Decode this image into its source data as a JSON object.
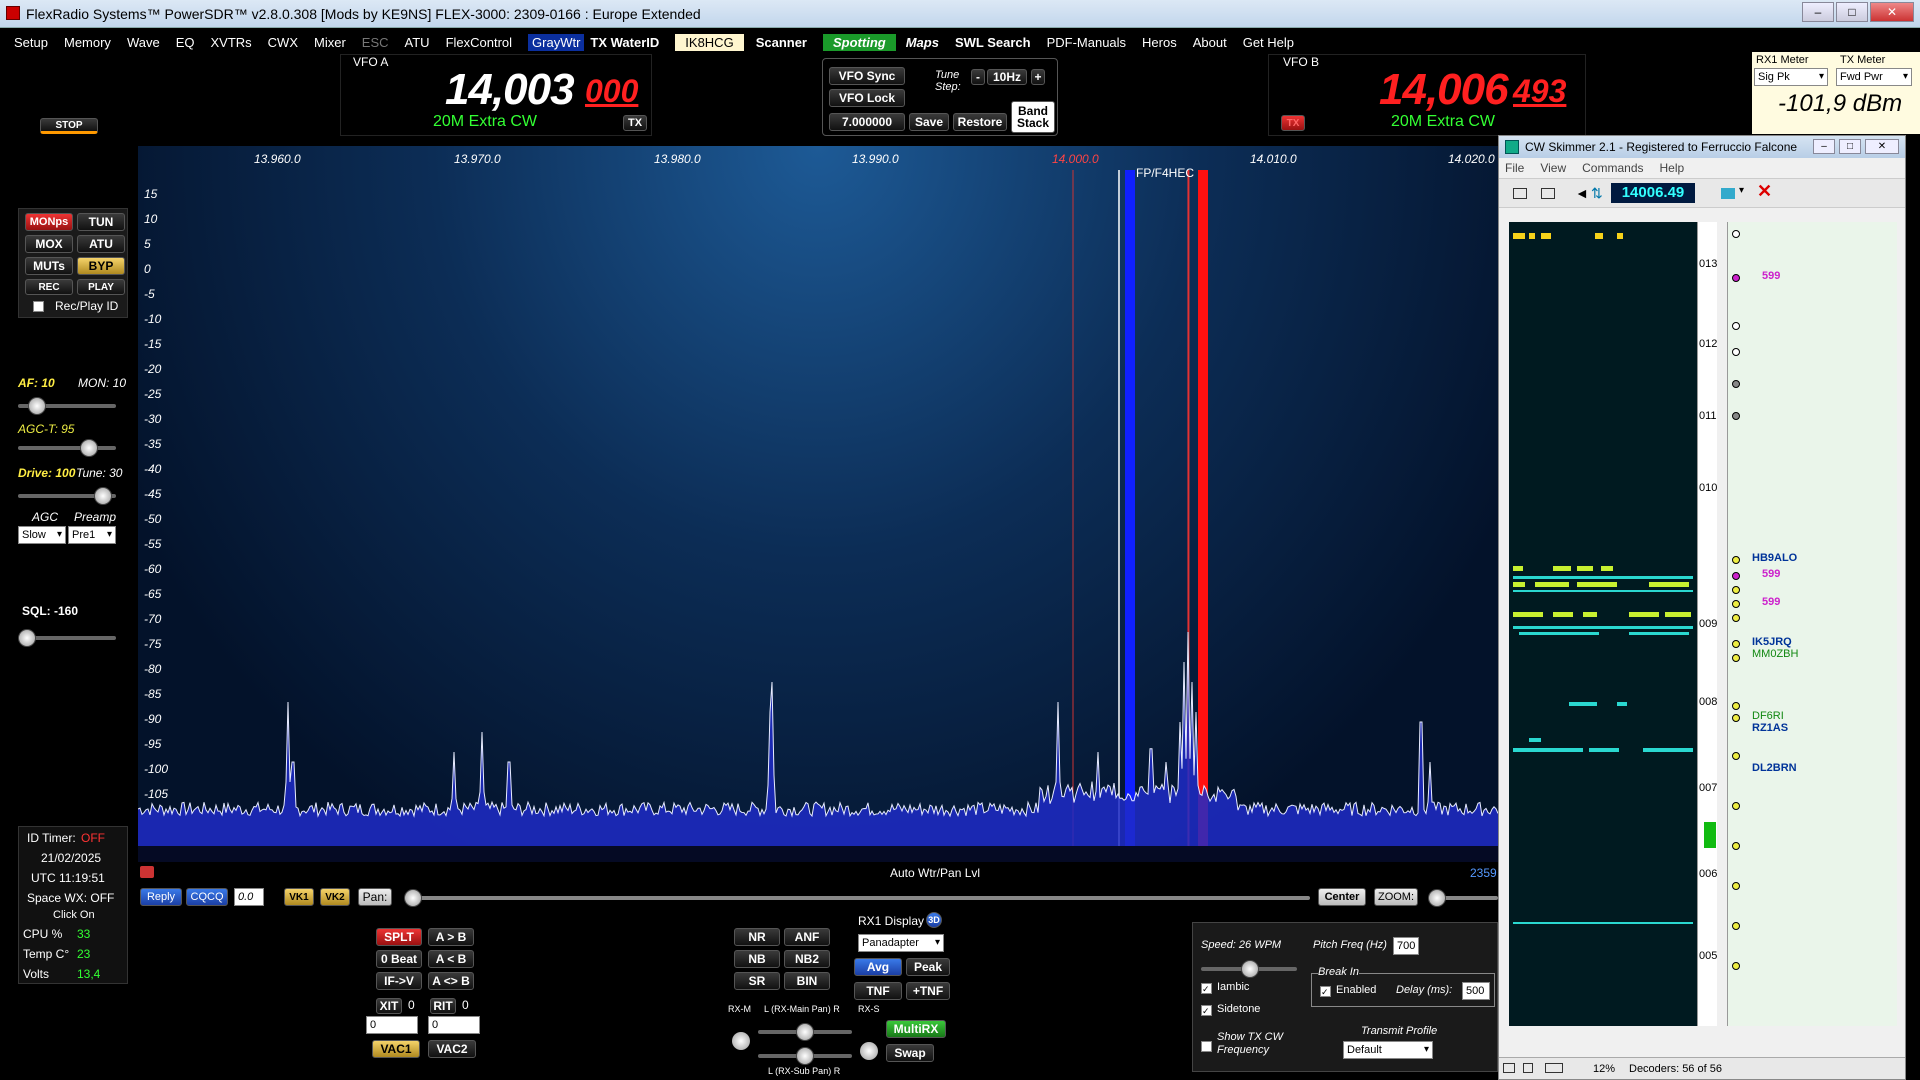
{
  "window": {
    "title": "FlexRadio Systems™  PowerSDR™  v2.8.0.308   [Mods by KE9NS]   FLEX-3000: 2309-0166 : Europe Extended"
  },
  "menu": [
    "Setup",
    "Memory",
    "Wave",
    "EQ",
    "XVTRs",
    "CWX",
    "Mixer",
    "ESC",
    "ATU",
    "FlexControl",
    "GrayWtr",
    "TX WaterID",
    "IK8HCG",
    "Scanner",
    "Spotting",
    "Maps",
    "SWL Search",
    "PDF-Manuals",
    "Heros",
    "About",
    "Get Help"
  ],
  "vfoA": {
    "label": "VFO A",
    "main": "14,003",
    "sub": "000",
    "band": "20M Extra CW",
    "tx": "TX"
  },
  "vfoB": {
    "label": "VFO B",
    "main": "14,006",
    "sub": "493",
    "band": "20M Extra CW",
    "tx": "TX"
  },
  "center": {
    "vfo_sync": "VFO Sync",
    "vfo_lock": "VFO Lock",
    "tune_label": "Tune Step:",
    "tune_step": "10Hz",
    "minus": "-",
    "plus": "+",
    "freq_box": "7.000000",
    "save": "Save",
    "restore": "Restore",
    "band_stack": "Band Stack"
  },
  "left": {
    "stop": "STOP",
    "buttons": [
      "MONps",
      "TUN",
      "MOX",
      "ATU",
      "MUTs",
      "BYP",
      "REC",
      "PLAY"
    ],
    "recplay": "Rec/Play ID",
    "af": "AF: 10",
    "mon": "MON: 10",
    "agct": "AGC-T: 95",
    "drive": "Drive: 100",
    "tune": "Tune: 30",
    "agc_label": "AGC",
    "preamp_label": "Preamp",
    "agc_value": "Slow",
    "preamp_value": "Pre1",
    "sql": "SQL: -160"
  },
  "status": {
    "id_timer_label": "ID Timer:",
    "id_timer_value": "OFF",
    "date": "21/02/2025",
    "utc": "UTC  11:19:51",
    "spacewx": "Space WX: OFF",
    "click_on": "Click On",
    "cpu_label": "CPU %",
    "cpu_value": "33",
    "temp_label": "Temp C°",
    "temp_value": "23",
    "volts_label": "Volts",
    "volts_value": "13,4"
  },
  "pan": {
    "y_labels": [
      "15",
      "10",
      "5",
      "0",
      "-5",
      "-10",
      "-15",
      "-20",
      "-25",
      "-30",
      "-35",
      "-40",
      "-45",
      "-50",
      "-55",
      "-60",
      "-65",
      "-70",
      "-75",
      "-80",
      "-85",
      "-90",
      "-95",
      "-100",
      "-105"
    ],
    "x_labels": [
      "13.960.0",
      "13.970.0",
      "13.980.0",
      "13.990.0",
      "14.000.0",
      "14.010.0",
      "14.020.0"
    ],
    "spot": "FP/F4HEC",
    "bottom_label": "Auto Wtr/Pan Lvl",
    "corner": "2359"
  },
  "lower": {
    "reply": "Reply",
    "cqcq": "CQCQ",
    "num": "0.0",
    "vk1": "VK1",
    "vk2": "VK2",
    "pan": "Pan:",
    "center": "Center",
    "zoom": "ZOOM:",
    "splt": "SPLT",
    "atob": "A > B",
    "zerobeat": "0 Beat",
    "btoa": "A < B",
    "ifv": "IF->V",
    "aswap": "A <> B",
    "xit": "XIT",
    "xit_v": "0",
    "rit": "RIT",
    "rit_v": "0",
    "xit_box": "0",
    "rit_box": "0",
    "vac1": "VAC1",
    "vac2": "VAC2",
    "nr": "NR",
    "anf": "ANF",
    "nb": "NB",
    "nb2": "NB2",
    "sr": "SR",
    "bin": "BIN",
    "rx1display": "RX1 Display",
    "threeD": "3D",
    "display_mode": "Panadapter",
    "avg": "Avg",
    "peak": "Peak",
    "tnf": "TNF",
    "ptnf": "+TNF",
    "rxm": "RX-M",
    "rxs": "RX-S",
    "mainpan": "L (RX-Main Pan) R",
    "subpan": "L (RX-Sub Pan) R",
    "multirx": "MultiRX",
    "swap": "Swap"
  },
  "cw": {
    "speed": "Speed:  26 WPM",
    "pitch": "Pitch Freq (Hz)",
    "pitch_v": "700",
    "iambic": "Iambic",
    "sidetone": "Sidetone",
    "breakin": "Break In",
    "enabled": "Enabled",
    "delay": "Delay (ms):",
    "delay_v": "500",
    "show_tx": "Show TX CW Frequency",
    "profile_label": "Transmit Profile",
    "profile": "Default"
  },
  "meter": {
    "rx1": "RX1 Meter",
    "tx": "TX Meter",
    "rx1_sel": "Sig Pk",
    "tx_sel": "Fwd Pwr",
    "reading": "-101,9 dBm"
  },
  "skimmer": {
    "title": "CW Skimmer 2.1 - Registered to Ferruccio Falcone",
    "menu": [
      "File",
      "View",
      "Commands",
      "Help"
    ],
    "freq": "14006.49",
    "ticks": [
      "013",
      "012",
      "011",
      "010",
      "009",
      "008",
      "007",
      "006",
      "005"
    ],
    "calls": [
      {
        "text": "599",
        "color": "#cc22cc"
      },
      {
        "text": "HB9ALO",
        "color": "#003399"
      },
      {
        "text": "599",
        "color": "#cc22cc"
      },
      {
        "text": "599",
        "color": "#cc22cc"
      },
      {
        "text": "IK5JRQ",
        "color": "#003399"
      },
      {
        "text": "MM0ZBH",
        "color": "#118811"
      },
      {
        "text": "DF6RI",
        "color": "#118811"
      },
      {
        "text": "RZ1AS",
        "color": "#003399"
      },
      {
        "text": "DL2BRN",
        "color": "#003399"
      }
    ],
    "status_pct": "12%",
    "status_dec": "Decoders: 56 of 56"
  }
}
